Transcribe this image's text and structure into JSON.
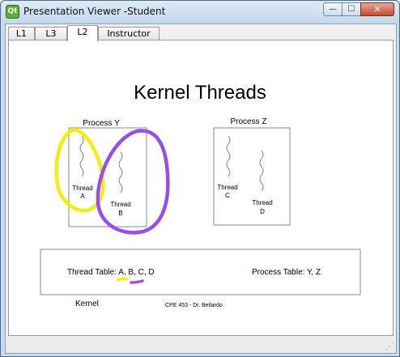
{
  "window": {
    "title": "Presentation Viewer -Student",
    "app_icon_label": "Qt",
    "minimize_glyph": "—",
    "maximize_glyph": "☐",
    "close_glyph": "✕"
  },
  "tabs": [
    {
      "label": "L1",
      "active": false
    },
    {
      "label": "L3",
      "active": false
    },
    {
      "label": "L2",
      "active": true
    },
    {
      "label": "Instructor",
      "active": false
    }
  ],
  "slide": {
    "title": "Kernel Threads",
    "process_y": {
      "label": "Process Y",
      "threads": [
        {
          "line1": "Thread",
          "line2": "A"
        },
        {
          "line1": "Thread",
          "line2": "B"
        }
      ]
    },
    "process_z": {
      "label": "Process Z",
      "threads": [
        {
          "line1": "Thread",
          "line2": "C"
        },
        {
          "line1": "Thread",
          "line2": "D"
        }
      ]
    },
    "kernel": {
      "label": "Kernel",
      "thread_table_label": "Thread Table: A, B, C, D",
      "process_table_label": "Process Table: Y, Z"
    },
    "footer": "CPE 453 - Dr. Bellardo",
    "annotations": {
      "yellow": "#f2ee13",
      "purple": "#9a4ee8"
    }
  }
}
